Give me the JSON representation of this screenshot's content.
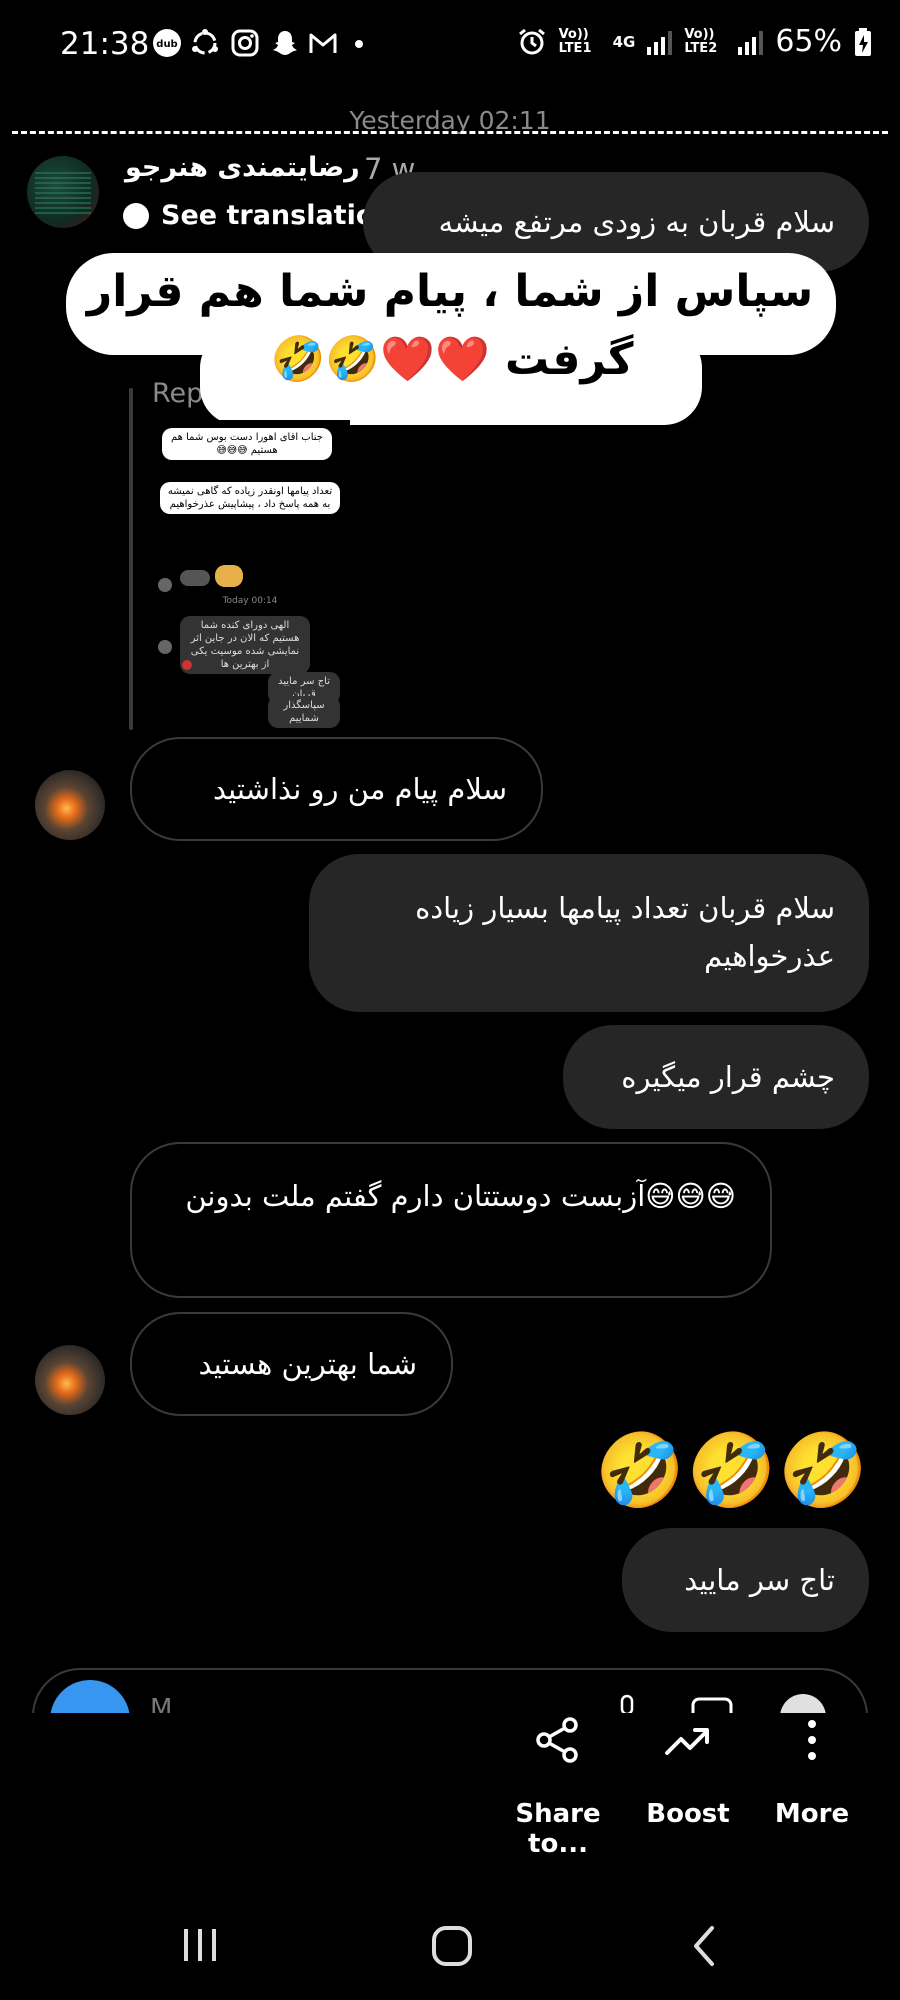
{
  "status_bar": {
    "time": "21:38",
    "left_icons": [
      "dub-icon",
      "sync-icon",
      "instagram-icon",
      "snapchat-icon",
      "gmail-icon",
      "dot-icon"
    ],
    "sim1_label": "Vo)) LTE1",
    "sim1_net": "4G",
    "sim2_label": "Vo)) LTE2",
    "battery": "65%"
  },
  "thread": {
    "date_divider": "Yesterday 02:11",
    "story_reply": {
      "user_name": "رضایتمندی هنرجو",
      "time_ago": "7 w",
      "see_translation": "See translation",
      "reply_label": "Rep",
      "story_line1": "سپاس از شما ، پیام شما هم قرار",
      "story_line2": "گرفت ❤️❤️🤣🤣",
      "thumb_texts": [
        "جناب اقای اهورا دست بوس شما هم هستیم 😅😅😅",
        "تعداد پیامها اونقدر زیاده که گاهی نمیشه به همه پاسخ داد ، پیشاپیش عذرخواهیم",
        "Today 00:14",
        "الهی دورای کنده شما هستیم که الان در جاین اثر نمایشی شده موسیت یکی از بهترین ها",
        "تاج سر مایید قربان",
        "سپاسگذار شماییم"
      ]
    },
    "messages": [
      {
        "id": "m1",
        "text": "سلام قربان به زودی مرتفع میشه",
        "side": "right"
      },
      {
        "id": "m2",
        "text": "سلام پیام من رو نذاشتید",
        "side": "left"
      },
      {
        "id": "m3",
        "text": "سلام قربان تعداد پیامها بسیار زیاده عذرخواهیم",
        "side": "right"
      },
      {
        "id": "m4",
        "text": "چشم قرار میگیره",
        "side": "right"
      },
      {
        "id": "m5",
        "text": "😅😅😅آزبست دوستتان دارم گفتم ملت بدونن",
        "side": "left"
      },
      {
        "id": "m6",
        "text": "شما بهترین هستید",
        "side": "left"
      },
      {
        "id": "m7",
        "text": "🤣🤣🤣🤣",
        "side": "right"
      },
      {
        "id": "m8",
        "text": "تاج سر مایید",
        "side": "right"
      }
    ]
  },
  "composer": {
    "placeholder": "M"
  },
  "actions": [
    {
      "label": "Share to...",
      "icon": "share-icon"
    },
    {
      "label": "Boost",
      "icon": "trending-up-icon"
    },
    {
      "label": "More",
      "icon": "more-vertical-icon"
    }
  ],
  "nav": [
    "recent-apps-icon",
    "home-icon",
    "back-icon"
  ],
  "colors": {
    "background": "#000000",
    "bubble_sent": "#262626",
    "bubble_received_border": "#3a3a3a",
    "accent_blue": "#3797f0",
    "meta_text": "#8a8a8a"
  }
}
